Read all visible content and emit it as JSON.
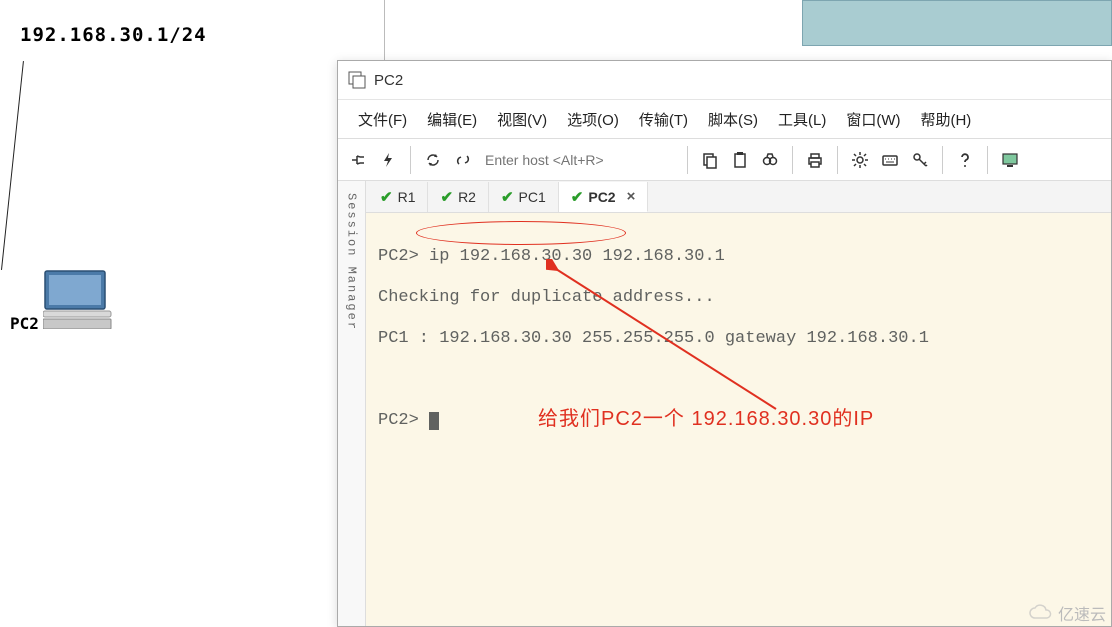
{
  "background": {
    "gateway_label": "192.168.30.1/24",
    "device_label": "PC2"
  },
  "window": {
    "title": "PC2"
  },
  "menu": {
    "file": "文件(F)",
    "edit": "编辑(E)",
    "view": "视图(V)",
    "options": "选项(O)",
    "transfer": "传输(T)",
    "script": "脚本(S)",
    "tools": "工具(L)",
    "window": "窗口(W)",
    "help": "帮助(H)"
  },
  "toolbar": {
    "host_placeholder": "Enter host <Alt+R>"
  },
  "session_manager": {
    "label": "Session Manager"
  },
  "tabs": {
    "items": [
      {
        "label": "R1",
        "active": false
      },
      {
        "label": "R2",
        "active": false
      },
      {
        "label": "PC1",
        "active": false
      },
      {
        "label": "PC2",
        "active": true
      }
    ],
    "close_glyph": "×"
  },
  "terminal": {
    "line1_prefix": "PC2> ",
    "line1_cmd": "ip 192.168.30.30 192.168.30.1",
    "line2": "Checking for duplicate address...",
    "line3": "PC1 : 192.168.30.30 255.255.255.0 gateway 192.168.30.1",
    "line4_prompt": "PC2> "
  },
  "annotation": {
    "text": "给我们PC2一个 192.168.30.30的IP"
  },
  "watermark": {
    "text": "亿速云"
  }
}
